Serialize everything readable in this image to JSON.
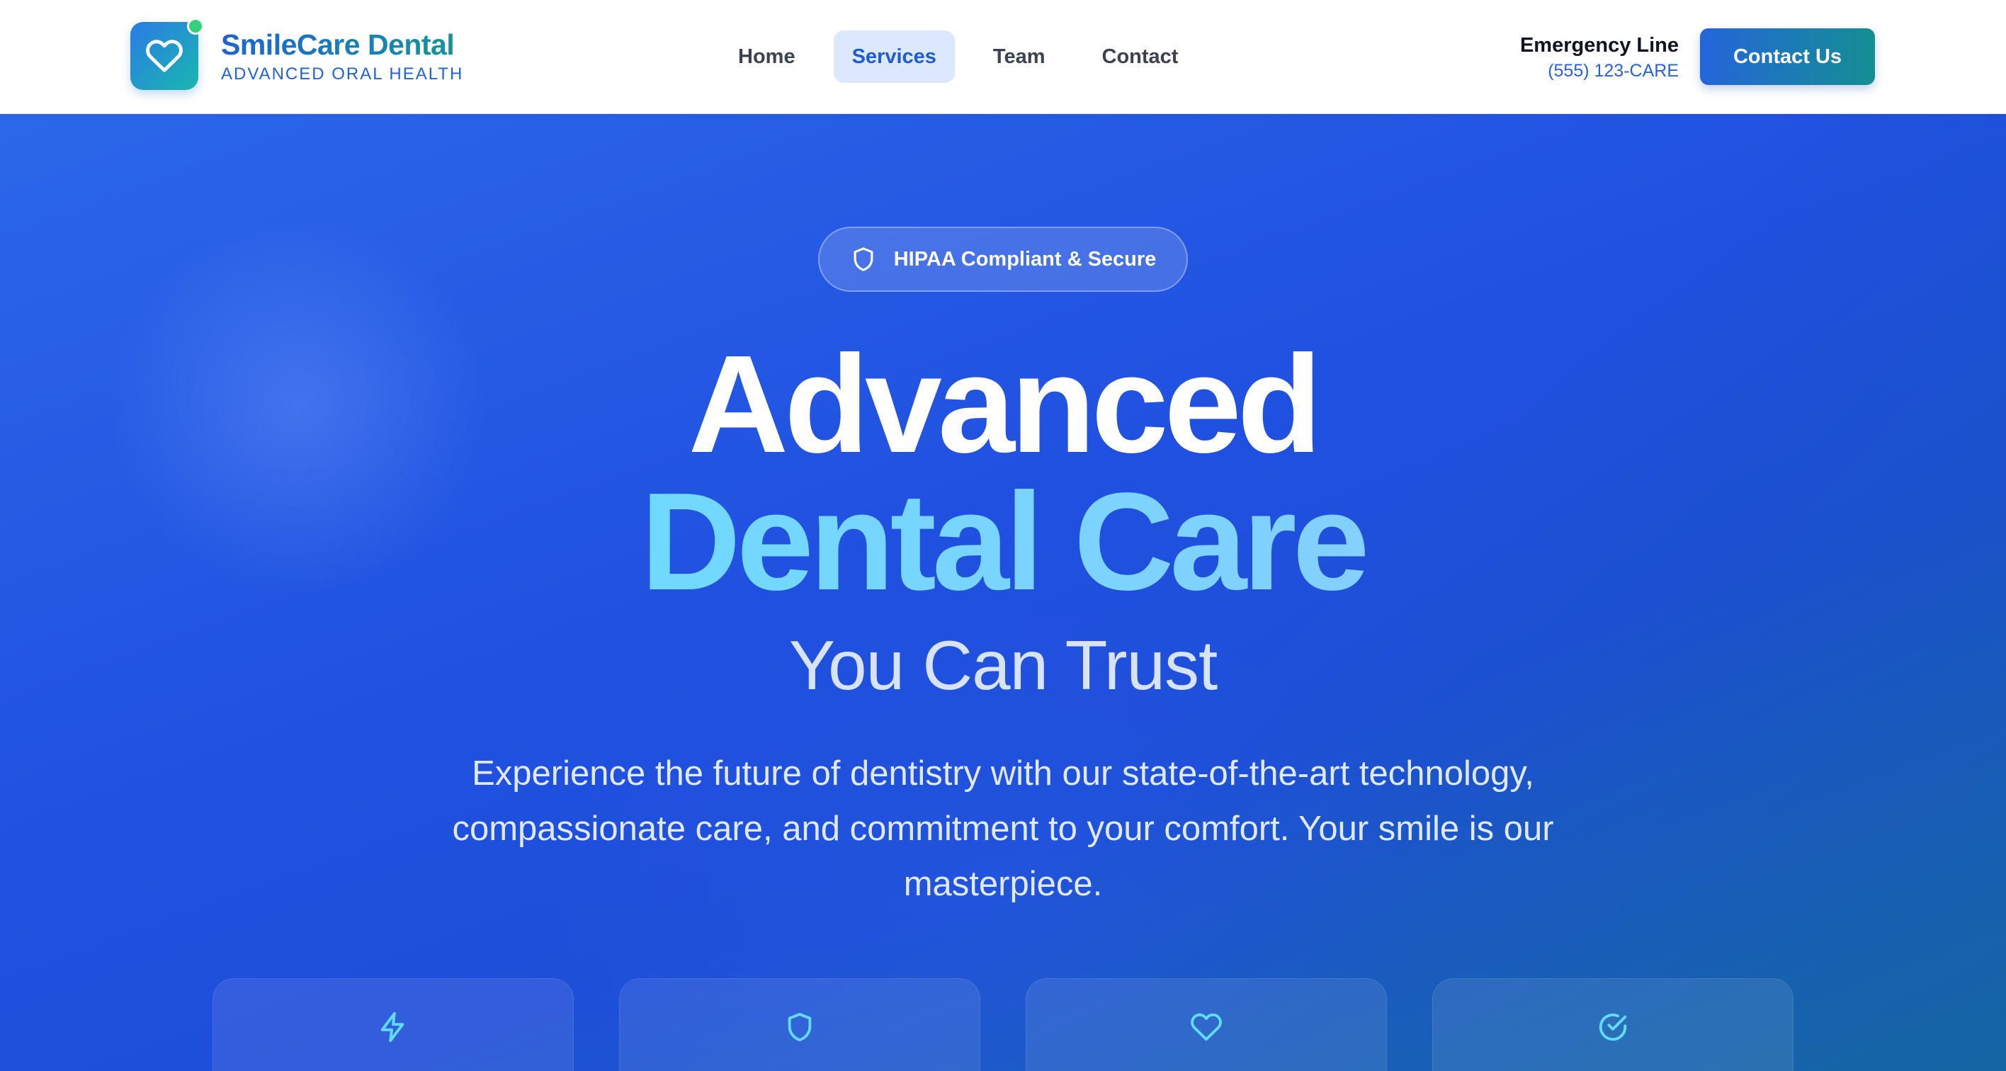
{
  "header": {
    "brand_name": "SmileCare Dental",
    "brand_tagline": "ADVANCED ORAL HEALTH",
    "logo_icon": "heart-icon",
    "nav": [
      {
        "label": "Home",
        "active": false
      },
      {
        "label": "Services",
        "active": true
      },
      {
        "label": "Team",
        "active": false
      },
      {
        "label": "Contact",
        "active": false
      }
    ],
    "emergency_label": "Emergency Line",
    "emergency_phone": "(555) 123-CARE",
    "cta_label": "Contact Us"
  },
  "hero": {
    "badge_icon": "shield-icon",
    "badge_text": "HIPAA Compliant & Secure",
    "headline_line1": "Advanced",
    "headline_line2": "Dental Care",
    "headline_line3": "You Can Trust",
    "description": "Experience the future of dentistry with our state-of-the-art technology, compassionate care, and commitment to your comfort. Your smile is our masterpiece.",
    "feature_icons": [
      "lightning-icon",
      "shield-icon",
      "heart-icon",
      "check-circle-icon"
    ]
  },
  "colors": {
    "brand_blue": "#2465db",
    "brand_teal": "#148f92",
    "hero_blue": "#2050e0",
    "accent_cyan": "#61e0ff",
    "nav_active_bg": "#dbe8fd"
  }
}
